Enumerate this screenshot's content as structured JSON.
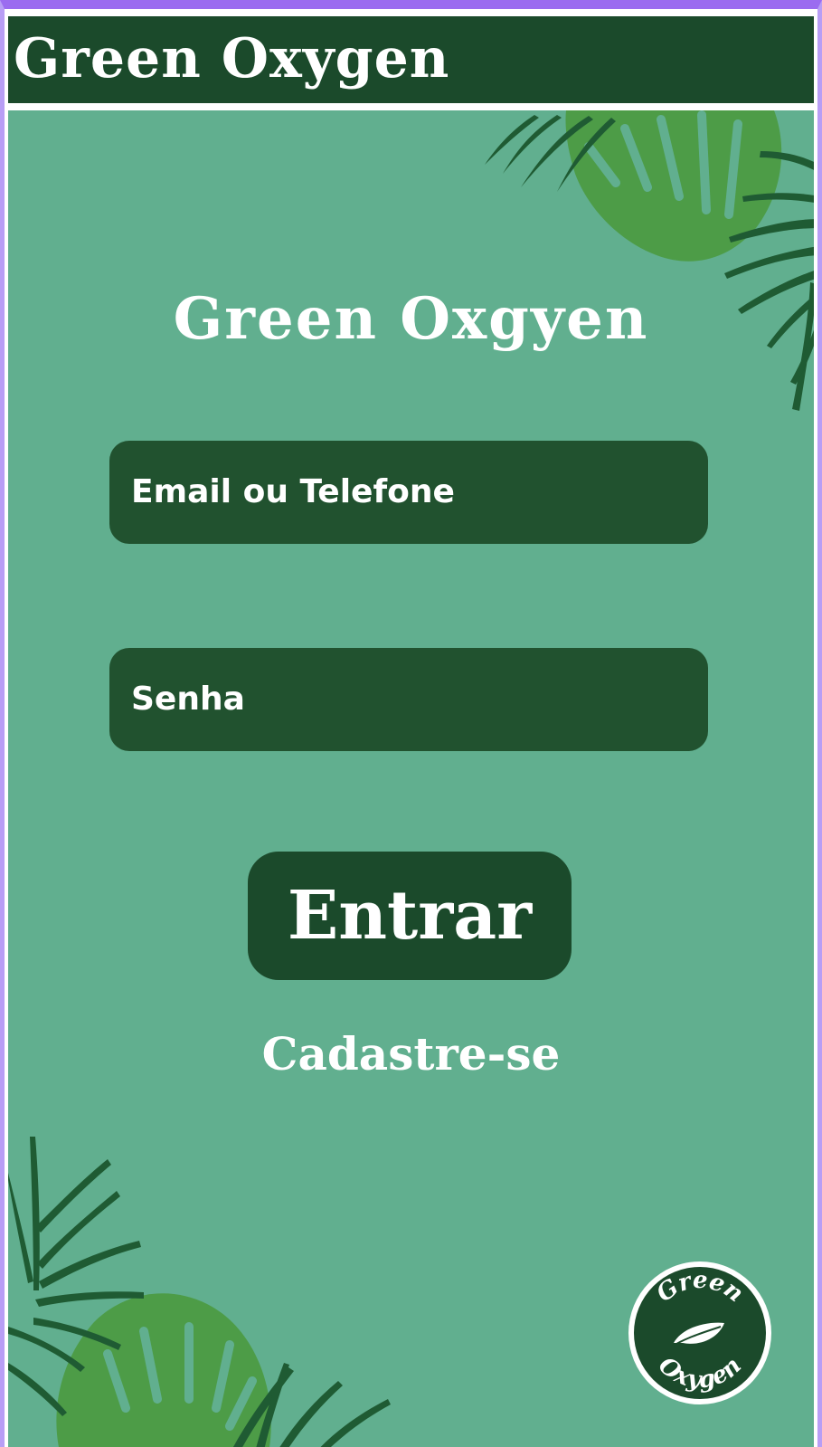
{
  "app": {
    "title": "Green Oxygen"
  },
  "login": {
    "heading": "Green Oxgyen",
    "email_placeholder": "Email ou Telefone",
    "password_placeholder": "Senha",
    "submit_label": "Entrar",
    "signup_label": "Cadastre-se"
  },
  "logo": {
    "text_top": "Green",
    "text_bottom": "Oxygen",
    "icon": "leaf-icon"
  },
  "colors": {
    "header_background": "#1b4a2b",
    "screen_background": "#61af8f",
    "input_background": "#21522f",
    "button_background": "#1b4a2b",
    "leaf_dark": "#1f5b33",
    "leaf_light": "#4d9c47",
    "text": "#ffffff"
  }
}
